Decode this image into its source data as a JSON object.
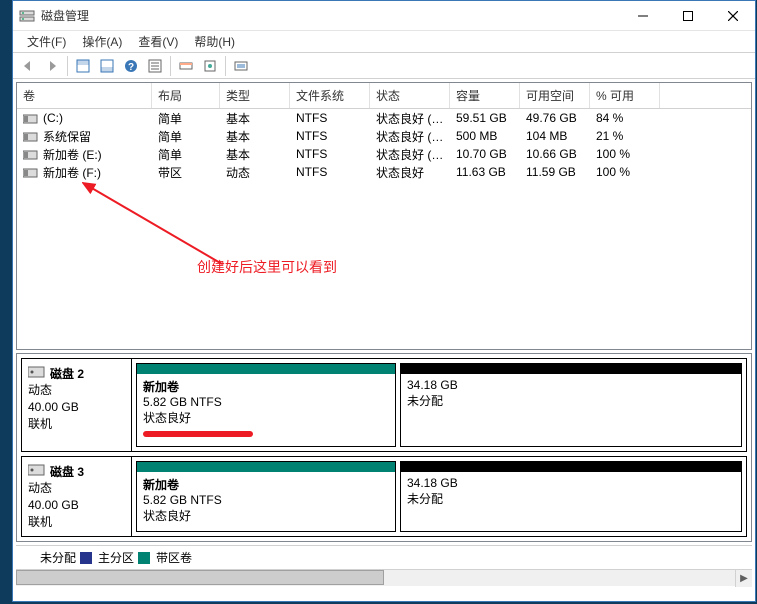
{
  "window": {
    "title": "磁盘管理"
  },
  "menus": {
    "file": "文件(F)",
    "action": "操作(A)",
    "view": "查看(V)",
    "help": "帮助(H)"
  },
  "columns": {
    "volume": "卷",
    "layout": "布局",
    "type": "类型",
    "filesystem": "文件系统",
    "status": "状态",
    "capacity": "容量",
    "free": "可用空间",
    "percent": "% 可用"
  },
  "volumes": [
    {
      "name": "(C:)",
      "layout": "简单",
      "type": "基本",
      "fs": "NTFS",
      "status": "状态良好 (…",
      "capacity": "59.51 GB",
      "free": "49.76 GB",
      "percent": "84 %"
    },
    {
      "name": "系统保留",
      "layout": "简单",
      "type": "基本",
      "fs": "NTFS",
      "status": "状态良好 (…",
      "capacity": "500 MB",
      "free": "104 MB",
      "percent": "21 %"
    },
    {
      "name": "新加卷 (E:)",
      "layout": "简单",
      "type": "基本",
      "fs": "NTFS",
      "status": "状态良好 (…",
      "capacity": "10.70 GB",
      "free": "10.66 GB",
      "percent": "100 %"
    },
    {
      "name": "新加卷 (F:)",
      "layout": "带区",
      "type": "动态",
      "fs": "NTFS",
      "status": "状态良好",
      "capacity": "11.63 GB",
      "free": "11.59 GB",
      "percent": "100 %"
    }
  ],
  "annotation": {
    "text": "创建好后这里可以看到"
  },
  "disks": [
    {
      "name": "磁盘 2",
      "type": "动态",
      "size": "40.00 GB",
      "status": "联机",
      "vols": [
        {
          "name": "新加卷",
          "info": "5.82 GB NTFS",
          "status": "状态良好",
          "stripe": "#008272",
          "flex": "0 0 260px",
          "underline": true
        },
        {
          "name": "",
          "info": "34.18 GB",
          "status": "未分配",
          "stripe": "#000000",
          "flex": "1"
        }
      ]
    },
    {
      "name": "磁盘 3",
      "type": "动态",
      "size": "40.00 GB",
      "status": "联机",
      "vols": [
        {
          "name": "新加卷",
          "info": "5.82 GB NTFS",
          "status": "状态良好",
          "stripe": "#008272",
          "flex": "0 0 260px"
        },
        {
          "name": "",
          "info": "34.18 GB",
          "status": "未分配",
          "stripe": "#000000",
          "flex": "1"
        }
      ]
    }
  ],
  "legend": {
    "unallocated": "未分配",
    "primary": "主分区",
    "striped": "带区卷"
  },
  "colors": {
    "unallocated": "#000000",
    "primary": "#26348b",
    "striped": "#008272"
  }
}
